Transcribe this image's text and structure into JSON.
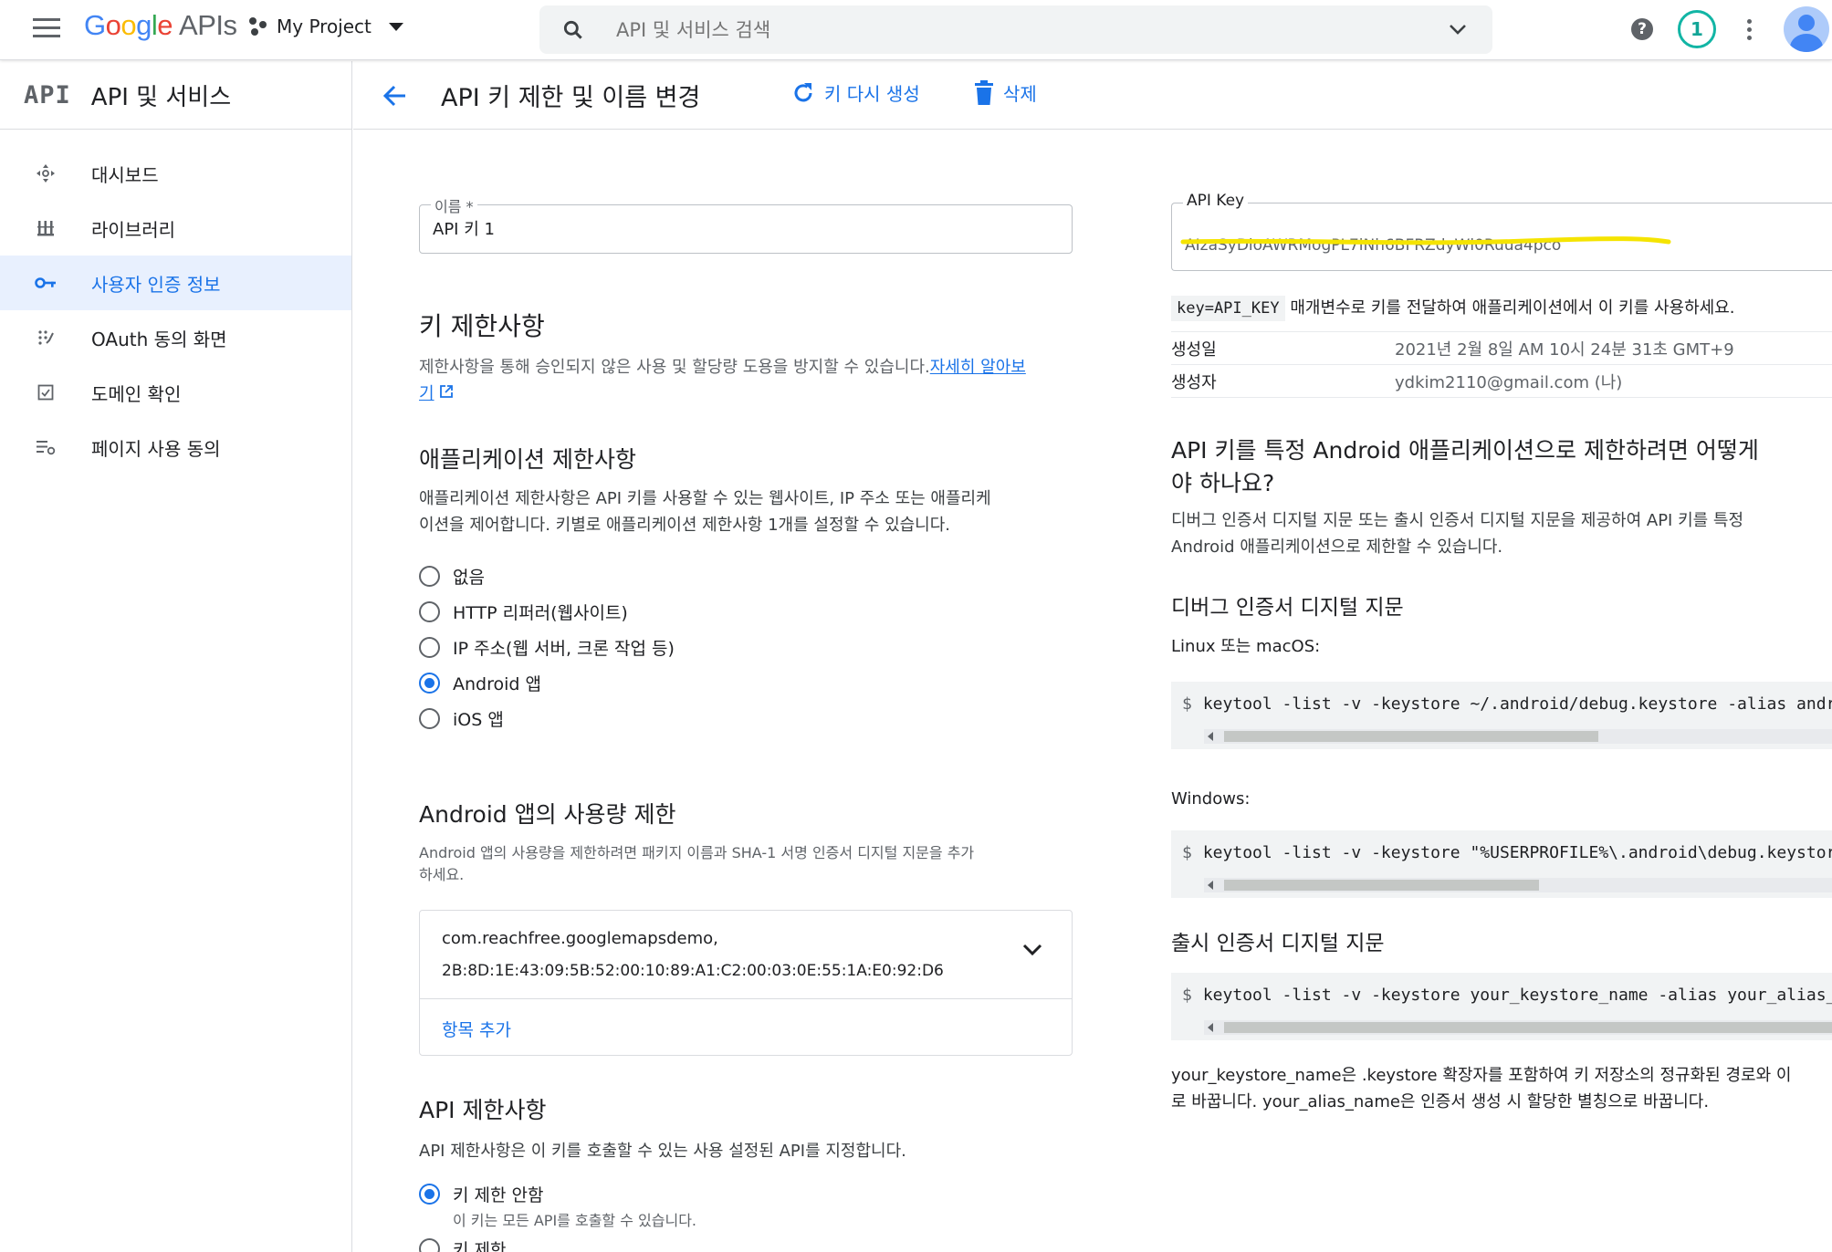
{
  "topbar": {
    "logo_google": "Google",
    "logo_apis": "APIs",
    "project": "My Project",
    "search_placeholder": "API 및 서비스 검색",
    "notification_count": "1",
    "help_glyph": "?"
  },
  "sidebar": {
    "mark": "API",
    "title": "API 및 서비스",
    "items": [
      {
        "label": "대시보드",
        "icon": "dashboard-icon"
      },
      {
        "label": "라이브러리",
        "icon": "library-icon"
      },
      {
        "label": "사용자 인증 정보",
        "icon": "key-icon",
        "active": true
      },
      {
        "label": "OAuth 동의 화면",
        "icon": "oauth-consent-icon"
      },
      {
        "label": "도메인 확인",
        "icon": "domain-verification-icon"
      },
      {
        "label": "페이지 사용 동의",
        "icon": "page-consent-icon"
      }
    ]
  },
  "header": {
    "title": "API 키 제한 및 이름 변경",
    "regen_label": "키 다시 생성",
    "delete_label": "삭제"
  },
  "form": {
    "name_label": "이름 *",
    "name_value": "API 키 1",
    "key_restrictions_title": "키 제한사항",
    "key_restrictions_desc": "제한사항을 통해 승인되지 않은 사용 및 할당량 도용을 방지할 수 있습니다.",
    "learn_more_1": "자세히 알아보",
    "learn_more_2": "기",
    "app_restrictions_title": "애플리케이션 제한사항",
    "app_restrictions_desc_1": "애플리케이션 제한사항은 API 키를 사용할 수 있는 웹사이트, IP 주소 또는 애플리케",
    "app_restrictions_desc_2": "이션을 제어합니다. 키별로 애플리케이션 제한사항 1개를 설정할 수 있습니다.",
    "app_options": [
      {
        "label": "없음",
        "checked": false
      },
      {
        "label": "HTTP 리퍼러(웹사이트)",
        "checked": false
      },
      {
        "label": "IP 주소(웹 서버, 크론 작업 등)",
        "checked": false
      },
      {
        "label": "Android 앱",
        "checked": true
      },
      {
        "label": "iOS 앱",
        "checked": false
      }
    ],
    "android_title": "Android 앱의 사용량 제한",
    "android_desc_1": "Android 앱의 사용량을 제한하려면 패키지 이름과 SHA-1 서명 인증서 디지털 지문을 추가",
    "android_desc_2": "하세요.",
    "package_name": "com.reachfree.googlemapsdemo,",
    "package_sha1": "2B:8D:1E:43:09:5B:52:00:10:89:A1:C2:00:03:0E:55:1A:E0:92:D6",
    "add_item": "항목 추가",
    "api_restrictions_title": "API 제한사항",
    "api_restrictions_desc": "API 제한사항은 이 키를 호출할 수 있는 사용 설정된 API를 지정합니다.",
    "api_option_1": "키 제한 안함",
    "api_option_1_sub": "이 키는 모든 API를 호출할 수 있습니다.",
    "api_option_2": "키 제한"
  },
  "keyinfo": {
    "label": "API Key",
    "value": "AIzaSyDloAWRMogPL7iNh6BFRZdyWl0Ruua4pco",
    "param": "key=API_KEY",
    "param_desc": "매개변수로 키를 전달하여 애플리케이션에서 이 키를 사용하세요.",
    "created_label": "생성일",
    "created_value": "2021년 2월 8일 AM 10시 24분 31초 GMT+9",
    "creator_label": "생성자",
    "creator_value": "ydkim2110@gmail.com (나)"
  },
  "help": {
    "title_1": "API 키를 특정 Android 애플리케이션으로 제한하려면 어떻게",
    "title_2": "야 하나요?",
    "desc_1": "디버그 인증서 디지털 지문 또는 출시 인증서 디지털 지문을 제공하여 API 키를 특정",
    "desc_2": "Android 애플리케이션으로 제한할 수 있습니다.",
    "debug_title": "디버그 인증서 디지털 지문",
    "linux_label": "Linux 또는 macOS:",
    "linux_cmd": "keytool -list -v -keystore ~/.android/debug.keystore -alias andr",
    "windows_label": "Windows:",
    "windows_cmd": "keytool -list -v -keystore \"%USERPROFILE%\\.android\\debug.keystor",
    "release_title": "출시 인증서 디지털 지문",
    "release_cmd": "keytool -list -v -keystore your_keystore_name -alias your_alias_",
    "prompt": "$",
    "footer_1": "your_keystore_name은 .keystore 확장자를 포함하여 키 저장소의 정규화된 경로와 이",
    "footer_2": "로 바꿉니다. your_alias_name은 인증서 생성 시 할당한 별칭으로 바꿉니다."
  },
  "colors": {
    "accent": "#1a73e8",
    "redaction": "#f5e400"
  }
}
